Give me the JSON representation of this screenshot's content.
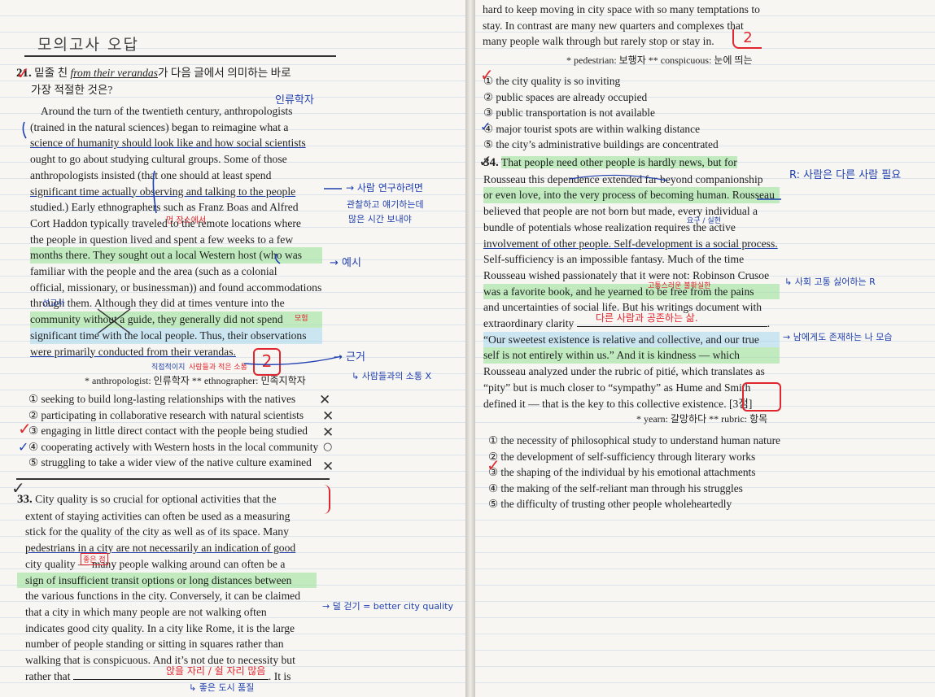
{
  "header_note": "모의고사 오답",
  "q21": {
    "number": "21.",
    "instruction_a": "밑줄 친 ",
    "instruction_u": "from their verandas",
    "instruction_b": "가 다음 글에서 의미하는 바로",
    "instruction_line2": "가장 적절한 것은?",
    "lines": [
      "Around the turn of the twentieth century, anthropologists",
      "(trained in the natural sciences) began to reimagine what a",
      "science of humanity should look like and how social scientists",
      "ought to go about studying cultural groups. Some of those",
      "anthropologists insisted (that one should at least spend",
      "significant time actually observing and talking to the people",
      "studied.) Early ethnographers such as Franz Boas and Alfred",
      "Cort Haddon typically traveled to the remote locations where",
      "the people in question lived and spent a few weeks to a few",
      "months there. They sought out a local Western host (who was",
      "familiar with the people and the area (such as a colonial",
      "official, missionary, or businessman)) and found accommodations",
      "through them. Although they did at times venture into the",
      "community without a guide, they generally did not spend",
      "significant time with the local people. Thus, their observations",
      "were primarily conducted from their verandas."
    ],
    "gloss": "* anthropologist: 인류학자   ** ethnographer: 민족지학자",
    "options": [
      "① seeking to build long-lasting relationships with the natives",
      "② participating in collaborative research with natural scientists",
      "③ engaging in little direct contact with the people being studied",
      "④ cooperating actively with Western hosts in the local community",
      "⑤ struggling to take a wider view of the native culture examined"
    ],
    "answer_mark": "2"
  },
  "q33": {
    "number": "33.",
    "lines": [
      "City quality is so crucial for optional activities that the",
      "extent of staying activities can often be used as a measuring",
      "stick for the quality of the city as well as of its space. Many",
      "pedestrians in a city are not necessarily an indication of good",
      "city quality — many people walking around can often be a",
      "sign of insufficient transit options or long distances between",
      "the various functions in the city. Conversely, it can be claimed",
      "that a city in which many people are not walking often",
      "indicates good city quality. In a city like Rome, it is the large",
      "number of people standing or sitting in squares rather than",
      "walking that is conspicuous. And it’s not due to necessity but",
      "rather that"
    ],
    "blank_tail": ". It is",
    "cont_lines": [
      "hard to keep moving in city space with so many temptations to",
      "stay. In contrast are many new quarters and complexes that",
      "many people walk through but rarely stop or stay in."
    ],
    "gloss": "* pedestrian: 보행자   ** conspicuous: 눈에 띄는",
    "options": [
      "① the city quality is so inviting",
      "② public spaces are already occupied",
      "③ public transportation is not available",
      "④ major tourist spots are within walking distance",
      "⑤ the city’s administrative buildings are concentrated"
    ],
    "answer_mark": "2"
  },
  "q34": {
    "number": "34.",
    "lines": [
      "That people need other people is hardly news, but for",
      "Rousseau this dependence extended far beyond companionship",
      "or even love, into the very process of becoming human. Rousseau",
      "believed that people are not born but made, every individual a",
      "bundle of potentials whose realization requires the active",
      "involvement of other people. Self-development is a social process.",
      "Self-sufficiency is an impossible fantasy. Much of the time",
      "Rousseau wished passionately that it were not: Robinson Crusoe",
      "was a favorite book, and he yearned to be free from the pains",
      "and uncertainties of social life. But his writings document with",
      "extraordinary clarity",
      "“Our sweetest existence is relative and collective, and our true",
      "self is not entirely within us.” And it is kindness — which",
      "Rousseau analyzed under the rubric of pitié, which translates as",
      "“pity” but is much closer to “sympathy” as Hume and Smith",
      "defined it — that is the key to this collective existence."
    ],
    "points": "[3점]",
    "gloss": "* yearn: 갈망하다   ** rubric: 항목",
    "options": [
      "① the necessity of philosophical study to understand human nature",
      "② the development of self-sufficiency through literary works",
      "③ the shaping of the individual by his emotional attachments",
      "④ the making of the self-reliant man through his struggles",
      "⑤ the difficulty of trusting other people wholeheartedly"
    ],
    "answer_mark": "3"
  },
  "notes": {
    "anthro_above": "인류학자",
    "study_people": "→ 사람 연구하려면",
    "observe_time1": "관찰하고 얘기하는데",
    "observe_time2": "많은 시간 보내야",
    "remote_place": "먼 장소에서",
    "example": "→ 예시",
    "missionary": "선교사",
    "venture": "모험",
    "evidence": "→ 근거",
    "little_contact": "↳ 사람들과의 소통 X",
    "few_contact1": "직접적이지",
    "few_contact2": "사람들과 적은 소통",
    "q33_side": "→ 덜 걷기 = better city quality",
    "blank_answer": "앉을 자리 / 쉴 자리 많음",
    "blank_under": "↳ 좋은 도시 품질",
    "q34_side_r": "R: 사람은 다른 사람 필요",
    "q34_side_social": "↳ 사회 고통 싫어하는 R",
    "blank34": "다른 사람과 공존하는 삶.",
    "q34_side_true": "→ 남에게도 존재하는 나 모습",
    "realize": "요구 / 실현",
    "pain_note": "고통스러운 불확실한",
    "good_mark": "좋은 점",
    "answer2_box": "2",
    "answer2_right": "2"
  }
}
